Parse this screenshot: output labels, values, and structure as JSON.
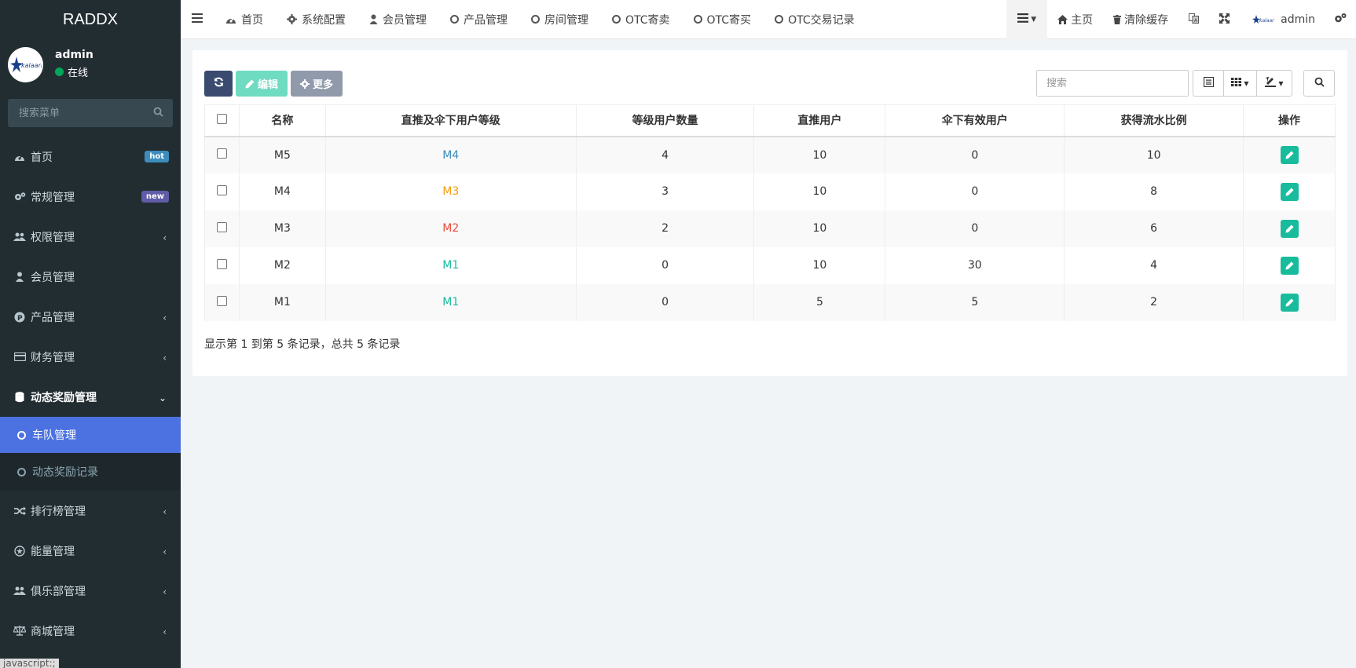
{
  "app": {
    "title": "RADDX"
  },
  "user": {
    "name": "admin",
    "status": "在线"
  },
  "sidebar": {
    "search_placeholder": "搜索菜单",
    "items": [
      {
        "label": "首页",
        "icon": "dashboard-icon",
        "badge": "hot"
      },
      {
        "label": "常规管理",
        "icon": "cogs-icon",
        "badge": "new"
      },
      {
        "label": "权限管理",
        "icon": "users-icon",
        "chevron": "left"
      },
      {
        "label": "会员管理",
        "icon": "user-icon"
      },
      {
        "label": "产品管理",
        "icon": "product-icon",
        "chevron": "left"
      },
      {
        "label": "财务管理",
        "icon": "credit-card-icon",
        "chevron": "left"
      },
      {
        "label": "动态奖励管理",
        "icon": "database-icon",
        "chevron": "down"
      }
    ],
    "submenu": [
      {
        "label": "车队管理",
        "active": true
      },
      {
        "label": "动态奖励记录",
        "active": false
      }
    ],
    "items_after": [
      {
        "label": "排行榜管理",
        "icon": "random-icon",
        "chevron": "left"
      },
      {
        "label": "能量管理",
        "icon": "energy-icon",
        "chevron": "left"
      },
      {
        "label": "俱乐部管理",
        "icon": "users-icon",
        "chevron": "left"
      },
      {
        "label": "商城管理",
        "icon": "balance-icon",
        "chevron": "left"
      }
    ],
    "status_hint": "javascript:;"
  },
  "topbar": {
    "tabs": [
      {
        "label": "首页",
        "icon": "dashboard-icon"
      },
      {
        "label": "系统配置",
        "icon": "gear-icon"
      },
      {
        "label": "会员管理",
        "icon": "user-icon"
      },
      {
        "label": "产品管理",
        "icon": "circle-icon"
      },
      {
        "label": "房间管理",
        "icon": "circle-icon"
      },
      {
        "label": "OTC寄卖",
        "icon": "circle-icon"
      },
      {
        "label": "OTC寄买",
        "icon": "circle-icon"
      },
      {
        "label": "OTC交易记录",
        "icon": "circle-icon"
      }
    ],
    "right": {
      "home_label": "主页",
      "clear_cache_label": "清除缓存",
      "admin_label": "admin"
    }
  },
  "toolbar": {
    "edit_label": "编辑",
    "more_label": "更多",
    "search_placeholder": "搜索"
  },
  "table": {
    "headers": [
      "名称",
      "直推及伞下用户等级",
      "等级用户数量",
      "直推用户",
      "伞下有效用户",
      "获得流水比例",
      "操作"
    ],
    "rows": [
      {
        "name": "M5",
        "level": "M4",
        "level_color": "#3c8dbc",
        "count": "4",
        "direct": "10",
        "umbrella": "0",
        "ratio": "10"
      },
      {
        "name": "M4",
        "level": "M3",
        "level_color": "#f39c12",
        "count": "3",
        "direct": "10",
        "umbrella": "0",
        "ratio": "8"
      },
      {
        "name": "M3",
        "level": "M2",
        "level_color": "#e74c3c",
        "count": "2",
        "direct": "10",
        "umbrella": "0",
        "ratio": "6"
      },
      {
        "name": "M2",
        "level": "M1",
        "level_color": "#18bc9c",
        "count": "0",
        "direct": "10",
        "umbrella": "30",
        "ratio": "4"
      },
      {
        "name": "M1",
        "level": "M1",
        "level_color": "#18bc9c",
        "count": "0",
        "direct": "5",
        "umbrella": "5",
        "ratio": "2"
      }
    ]
  },
  "pagination_info": "显示第 1 到第 5 条记录，总共 5 条记录",
  "colors": {
    "sidebar_bg": "#222d32",
    "active_menu": "#4c72e1",
    "edit_button": "#18bc9c"
  }
}
